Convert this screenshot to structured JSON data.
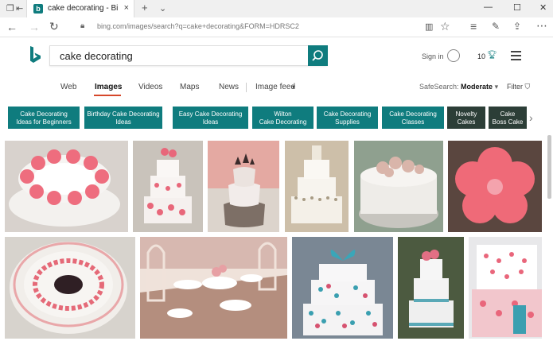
{
  "window": {
    "tab_title": "cake decorating - Bing i",
    "tab_close": "×",
    "new_tab": "+",
    "tab_list": "⌄"
  },
  "address": {
    "url": "bing.com/images/search?q=cake+decorating&FORM=HDRSC2"
  },
  "search": {
    "query": "cake decorating"
  },
  "account": {
    "sign_in": "Sign in",
    "rewards": "10"
  },
  "scopes": [
    "Web",
    "Images",
    "Videos",
    "Maps",
    "News",
    "Image feed"
  ],
  "safesearch": {
    "label": "SafeSearch:",
    "value": "Moderate",
    "filter": "Filter"
  },
  "chips": [
    {
      "l1": "Cake Decorating",
      "l2": "Ideas for Beginners"
    },
    {
      "l1": "Birthday Cake Decorating",
      "l2": "Ideas"
    },
    {
      "l1": "Easy Cake Decorating",
      "l2": "Ideas"
    },
    {
      "l1": "Wilton",
      "l2": "Cake Decorating"
    },
    {
      "l1": "Cake Decorating",
      "l2": "Supplies"
    },
    {
      "l1": "Cake Decorating",
      "l2": "Classes"
    },
    {
      "l1": "Novelty",
      "l2": "Cakes"
    },
    {
      "l1": "Cake",
      "l2": "Boss Cake"
    }
  ],
  "colors": {
    "accent": "#0f7c7e",
    "active_underline": "#d6472a"
  }
}
